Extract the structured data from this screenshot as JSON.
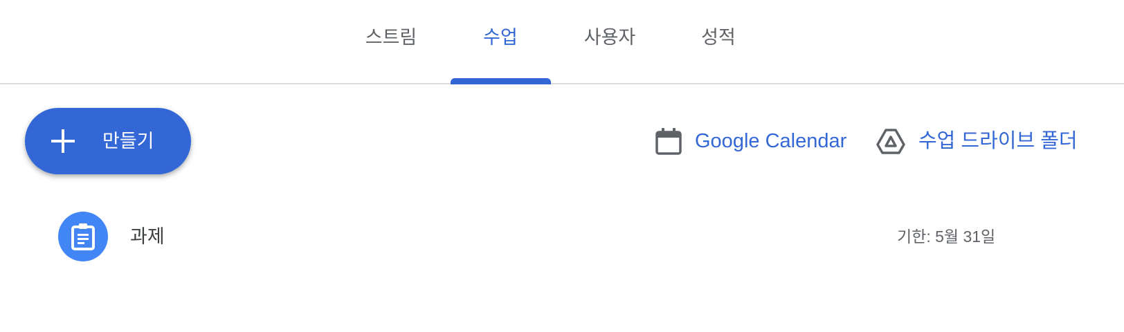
{
  "tabs": [
    {
      "label": "스트림",
      "active": false
    },
    {
      "label": "수업",
      "active": true
    },
    {
      "label": "사용자",
      "active": false
    },
    {
      "label": "성적",
      "active": false
    }
  ],
  "create_button": {
    "label": "만들기",
    "icon": "plus-icon"
  },
  "links": {
    "calendar": {
      "label": "Google Calendar",
      "icon": "calendar-icon"
    },
    "drive": {
      "label": "수업 드라이브 폴더",
      "icon": "drive-icon"
    }
  },
  "items": [
    {
      "title": "과제",
      "due": "기한: 5월 31일",
      "icon": "assignment-icon"
    }
  ],
  "colors": {
    "accent": "#3367d6",
    "avatar": "#4285f4",
    "muted_text": "#5f6368",
    "divider": "#dadce0"
  }
}
